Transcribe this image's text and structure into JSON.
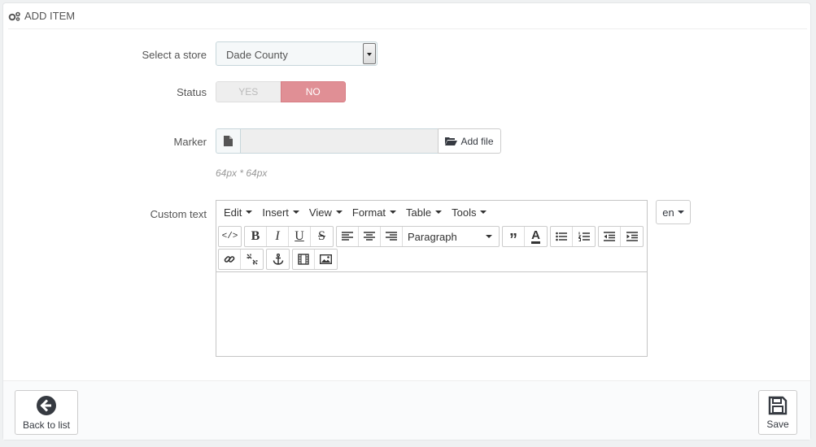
{
  "header": {
    "title": "ADD ITEM",
    "icon": "gears-icon"
  },
  "form": {
    "store": {
      "label": "Select a store",
      "value": "Dade County"
    },
    "status": {
      "label": "Status",
      "yes": "YES",
      "no": "NO",
      "selected": "NO"
    },
    "marker": {
      "label": "Marker",
      "button": "Add file",
      "hint": "64px * 64px"
    },
    "custom_text": {
      "label": "Custom text",
      "language": "en"
    }
  },
  "editor": {
    "menus": [
      "Edit",
      "Insert",
      "View",
      "Format",
      "Table",
      "Tools"
    ],
    "format_dropdown": "Paragraph"
  },
  "footer": {
    "back_label": "Back to list",
    "save_label": "Save"
  },
  "colors": {
    "status_no": "#e08f95",
    "accent": "#363a41"
  }
}
